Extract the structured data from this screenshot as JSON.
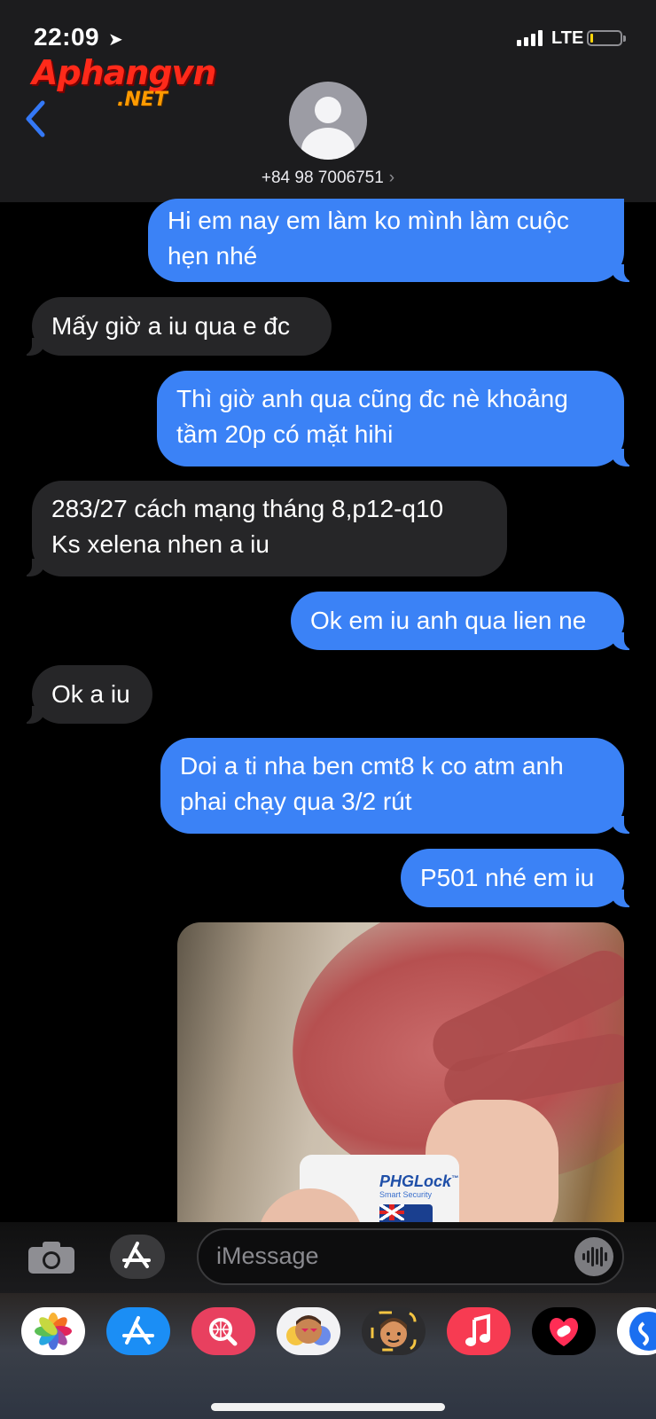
{
  "status_bar": {
    "time": "22:09",
    "network": "LTE",
    "battery_level": 0.08
  },
  "watermark": {
    "name": "Aphangvn",
    "suffix": ".NET"
  },
  "header": {
    "contact": "+84 98 7006751",
    "contact_chevron": "›",
    "back_icon": "chevron-left-icon",
    "avatar_icon": "person-silhouette-icon"
  },
  "messages": [
    {
      "dir": "sent",
      "text": "Hi em nay em làm ko mình làm cuộc\nhẹn nhé"
    },
    {
      "dir": "received",
      "text": "Mấy giờ a iu qua e đc"
    },
    {
      "dir": "sent",
      "text": "Thì giờ anh qua cũng đc nè khoảng\ntầm 20p có mặt hihi"
    },
    {
      "dir": "received",
      "text": "283/27 cách mạng tháng 8,p12-q10\nKs xelena nhen a iu"
    },
    {
      "dir": "sent",
      "text": "Ok em iu anh qua lien ne"
    },
    {
      "dir": "received",
      "text": "Ok a iu"
    },
    {
      "dir": "sent",
      "text": "Doi a ti nha ben cmt8 k co atm anh\nphai chạy qua 3/2 rút"
    },
    {
      "dir": "sent",
      "text": "P501 nhé em iu"
    }
  ],
  "photo_message": {
    "dir": "sent",
    "card_brand": "PHGLock",
    "card_tm": "™",
    "card_tagline": "Smart Security"
  },
  "composer": {
    "camera_icon": "camera-icon",
    "apps_icon": "app-store-icon",
    "placeholder": "iMessage",
    "audio_icon": "waveform-icon"
  },
  "app_tray": [
    {
      "name": "Photos",
      "icon": "photos-icon"
    },
    {
      "name": "App Store",
      "icon": "app-store-icon"
    },
    {
      "name": "Images",
      "icon": "image-search-icon"
    },
    {
      "name": "Memoji Stickers",
      "icon": "memoji-stickers-icon"
    },
    {
      "name": "Memoji",
      "icon": "memoji-icon"
    },
    {
      "name": "Music",
      "icon": "music-icon"
    },
    {
      "name": "Digital Touch",
      "icon": "digital-touch-icon"
    },
    {
      "name": "Shazam",
      "icon": "shazam-icon"
    }
  ],
  "colors": {
    "sent_bubble": "#3b82f6",
    "received_bubble": "#262628",
    "background": "#000000",
    "header": "#1c1c1e",
    "accent": "#3478f6"
  }
}
